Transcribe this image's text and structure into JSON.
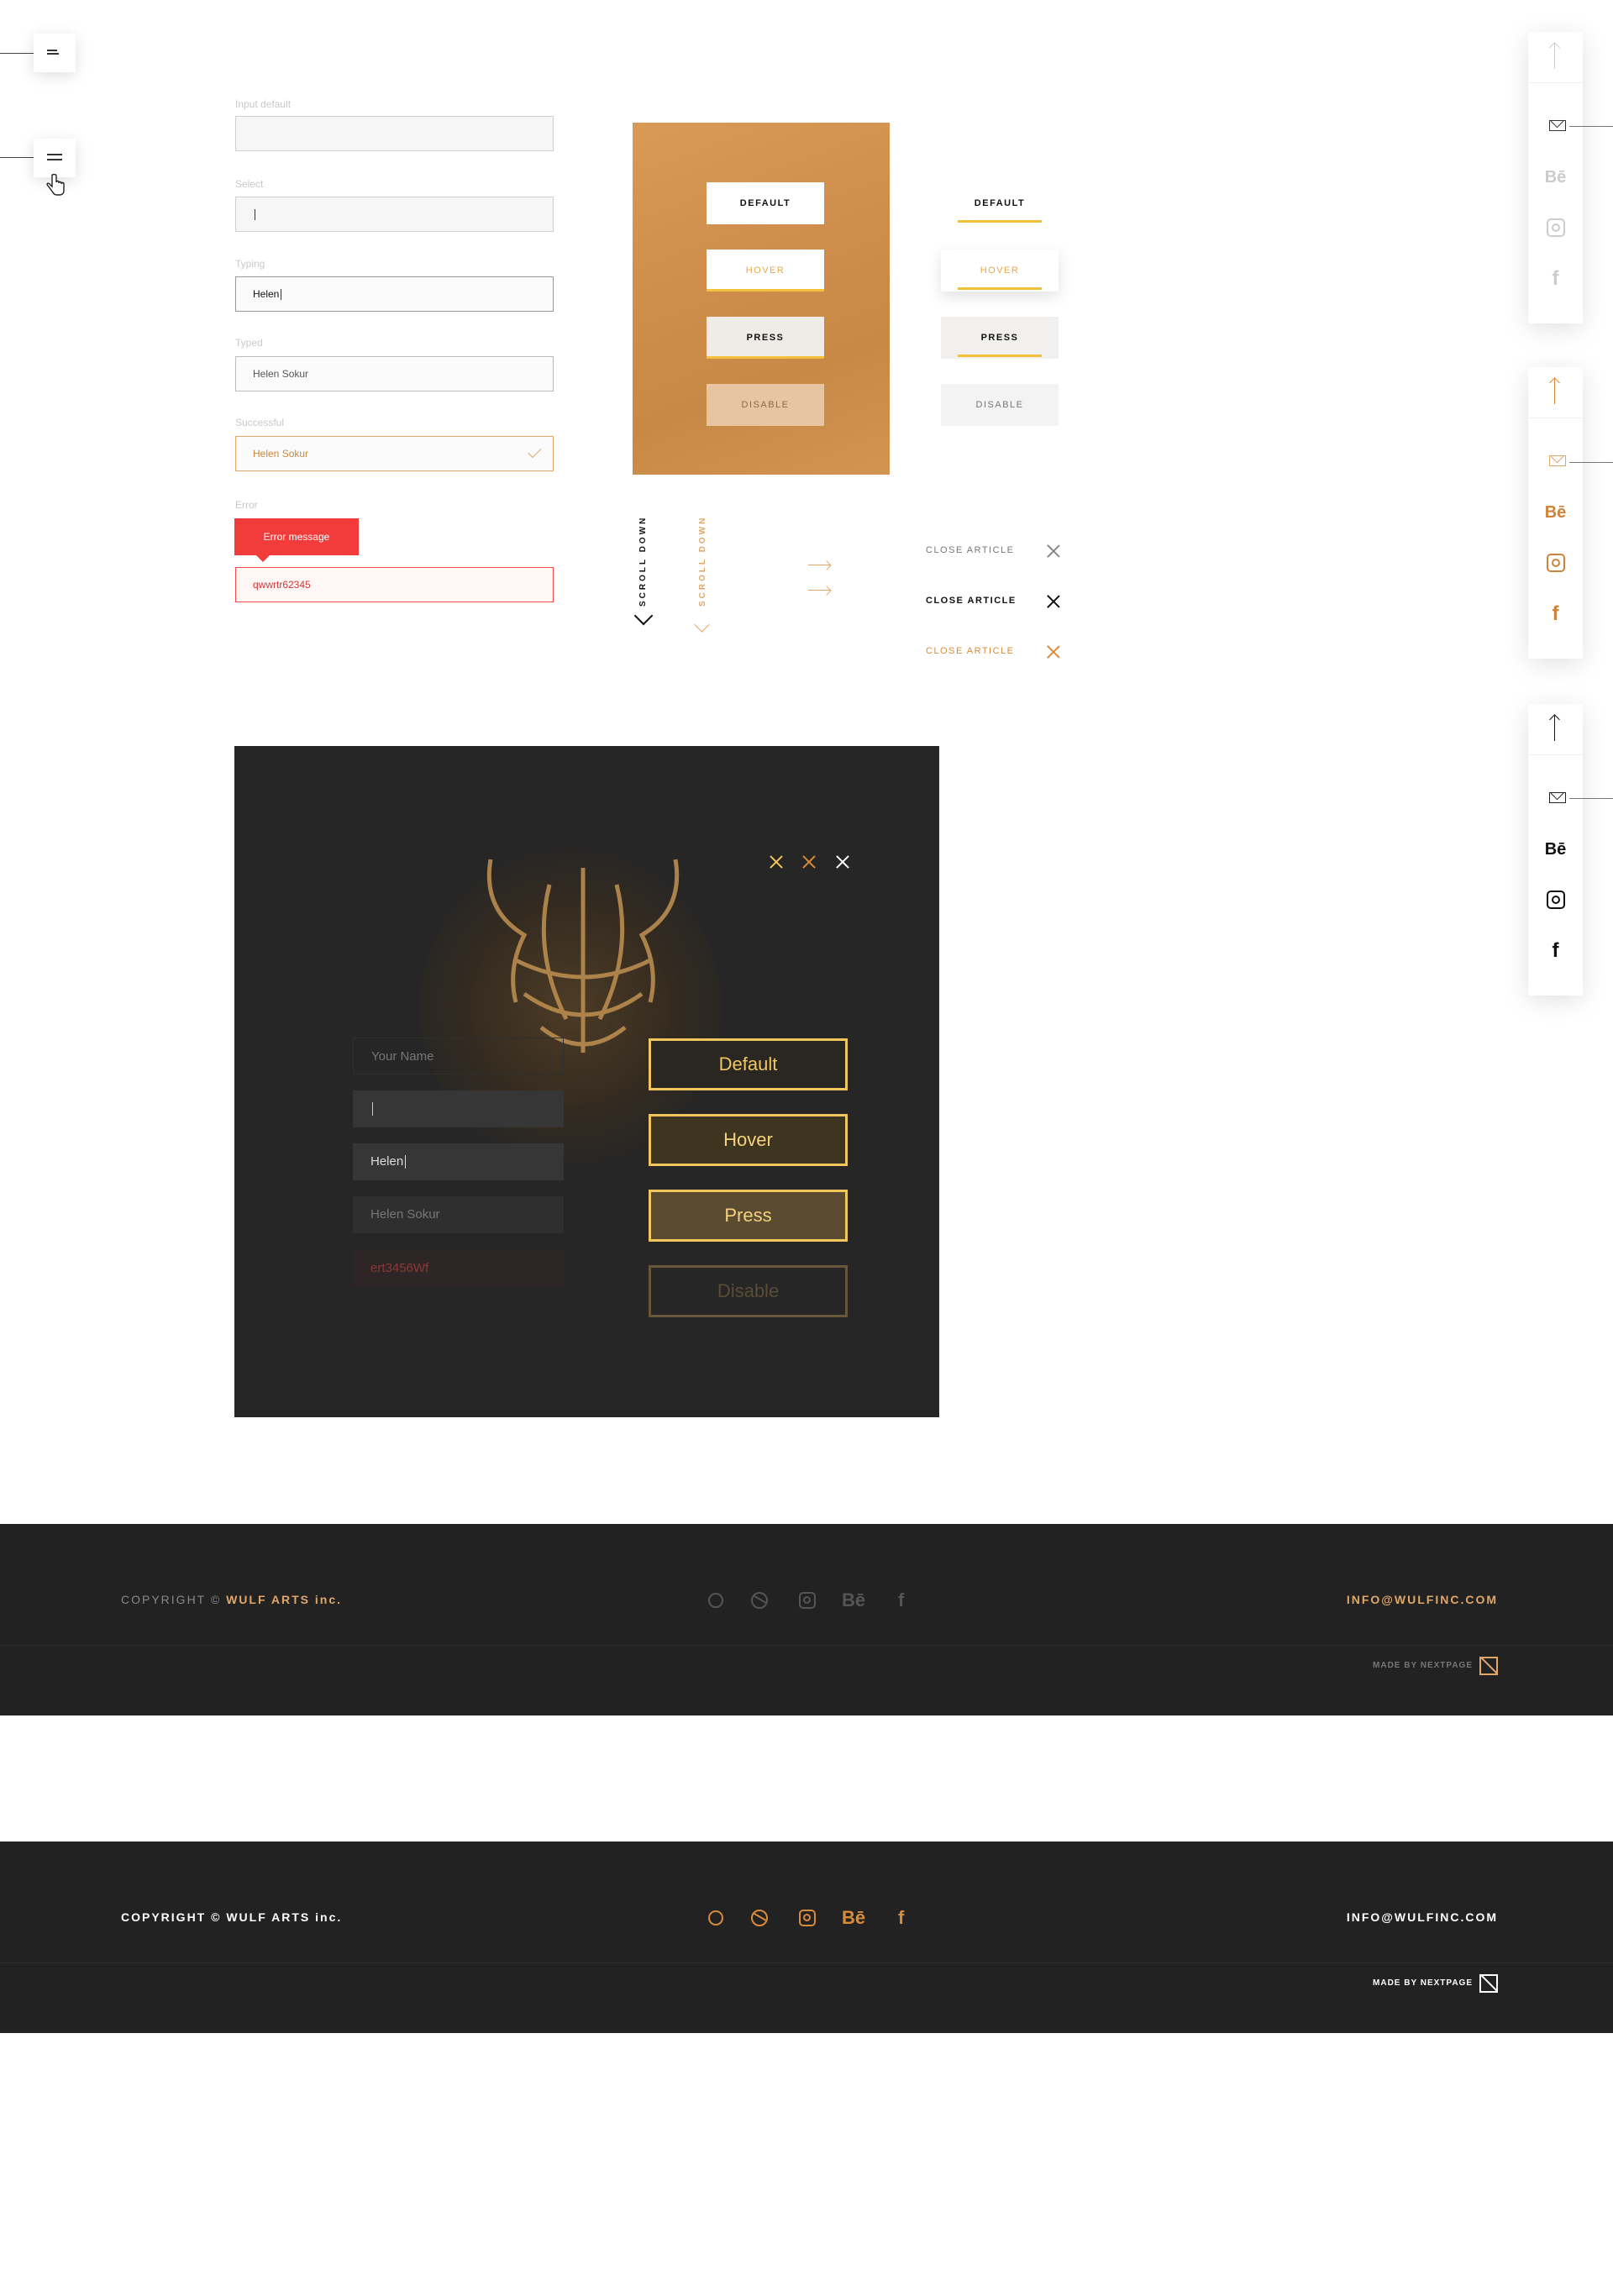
{
  "inputs": {
    "default": {
      "label": "Input default",
      "value": ""
    },
    "select": {
      "label": "Select",
      "value": ""
    },
    "typing": {
      "label": "Typing",
      "value": "Helen"
    },
    "typed": {
      "label": "Typed",
      "value": "Helen Sokur"
    },
    "successful": {
      "label": "Successful",
      "value": "Helen Sokur"
    },
    "error": {
      "label": "Error",
      "value": "qwwrtr62345",
      "message": "Error message"
    }
  },
  "buttons": {
    "default": "DEFAULT",
    "hover": "HOVER",
    "press": "PRESS",
    "disable": "DISABLE"
  },
  "scroll": {
    "label": "SCROLL DOWN"
  },
  "close_article": {
    "label": "CLOSE ARTICLE"
  },
  "share_bar": {
    "behance": "Bē",
    "facebook": "f"
  },
  "dark_form": {
    "inputs": [
      "Your Name",
      "",
      "Helen",
      "Helen Sokur",
      "ert3456Wf"
    ],
    "buttons": [
      "Default",
      "Hover",
      "Press",
      "Disable"
    ]
  },
  "footer": {
    "copyright_prefix": "COPYRIGHT © ",
    "copyright_brand": "WULF ARTS inc.",
    "email": "INFO@WULFINC.COM",
    "made_by": "MADE BY NEXTPAGE",
    "behance": "Bē",
    "facebook": "f"
  },
  "colors": {
    "accent": "#e0a66a",
    "yellow": "#f2c03a",
    "error": "#f23c3c",
    "dark": "#222222",
    "gold": "#f0c65d"
  },
  "icons": [
    "menu-icon",
    "hand-cursor-icon",
    "arrow-up-icon",
    "mail-icon",
    "behance-icon",
    "instagram-icon",
    "facebook-icon",
    "close-icon",
    "chevron-down-icon",
    "arrow-right-icon",
    "check-icon",
    "pinterest-icon",
    "dribbble-icon",
    "nextpage-logo-icon"
  ]
}
